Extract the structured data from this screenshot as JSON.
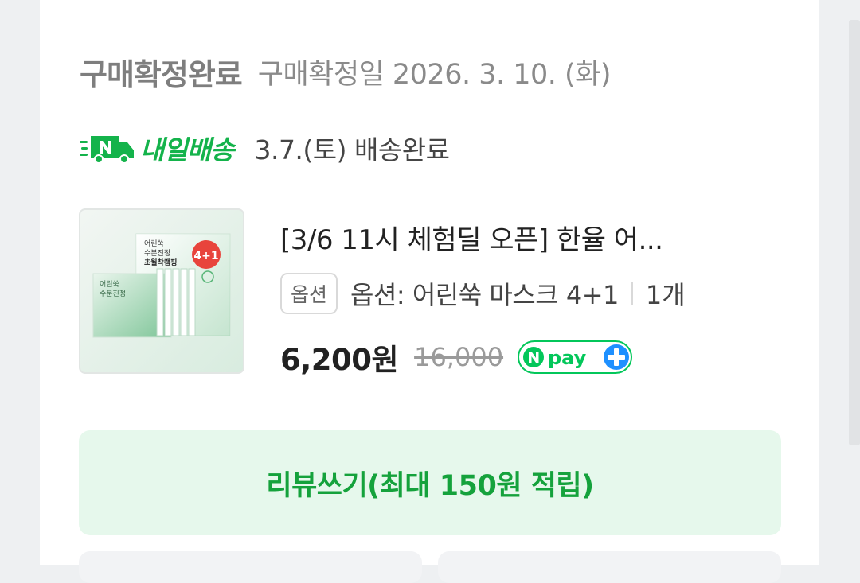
{
  "order": {
    "status_title": "구매확정완료",
    "status_date": "구매확정일 2026. 3. 10. (화)"
  },
  "delivery": {
    "icon": "n-delivery-truck-icon",
    "service_name": "내일배송",
    "status": "3.7.(토) 배송완료"
  },
  "product": {
    "title": "[3/6 11시 체험딜 오픈] 한율 어...",
    "option_badge": "옵션",
    "option_text": "옵션: 어린쑥 마스크 4+1",
    "quantity": "1개",
    "price": "6,200원",
    "original_price": "16,000",
    "pay_badge": "npay-plus",
    "thumbnail": {
      "box_line1": "어린쑥",
      "box_line2": "수분진정",
      "box_line3": "초월착캠핑",
      "promo": "4+1",
      "pack_line1": "어린쑥",
      "pack_line2": "수분진정"
    }
  },
  "review": {
    "button_label": "리뷰쓰기(최대 150원 적립)"
  },
  "colors": {
    "brand_green": "#14b34b",
    "review_bg": "#e6f8ec",
    "review_text": "#15a23c",
    "npay_green": "#03c75a",
    "npay_blue": "#1e90ff"
  }
}
